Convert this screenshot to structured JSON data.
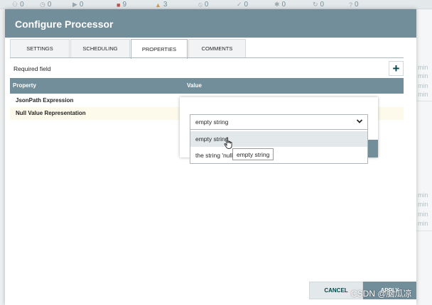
{
  "status_bar": [
    {
      "icon": "cluster-icon",
      "value": "0"
    },
    {
      "icon": "stopwatch-icon",
      "value": "0"
    },
    {
      "icon": "play-icon",
      "value": "0"
    },
    {
      "icon": "stop-icon",
      "value": "9"
    },
    {
      "icon": "warning-icon",
      "value": "3"
    },
    {
      "icon": "disabled-icon",
      "value": "0"
    },
    {
      "icon": "check-icon",
      "value": "0"
    },
    {
      "icon": "asterisk-icon",
      "value": "0"
    },
    {
      "icon": "refresh-icon",
      "value": "0"
    },
    {
      "icon": "question-icon",
      "value": "0"
    }
  ],
  "background": {
    "min_label": "min"
  },
  "dialog": {
    "title": "Configure Processor",
    "tabs": [
      "SETTINGS",
      "SCHEDULING",
      "PROPERTIES",
      "COMMENTS"
    ],
    "active_tab": "PROPERTIES",
    "required_label": "Required field",
    "add_button": "+"
  },
  "grid": {
    "headers": {
      "property": "Property",
      "value": "Value"
    },
    "rows": [
      {
        "property": "JsonPath Expression"
      },
      {
        "property": "Null Value Representation"
      }
    ]
  },
  "editor": {
    "selected_value": "empty string",
    "options": [
      "empty string",
      "the string 'null'"
    ],
    "tooltip": "empty string"
  },
  "footer": {
    "cancel_label": "CANCEL",
    "apply_label": "APPLY",
    "watermark": "CSDN @脑瓜凉"
  }
}
